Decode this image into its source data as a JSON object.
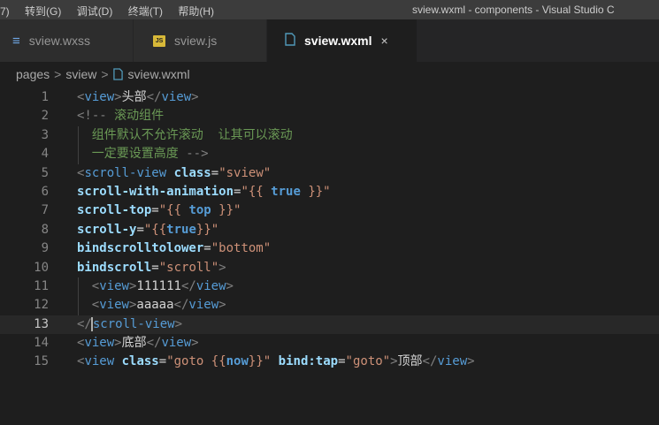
{
  "menu": {
    "items": [
      "7)",
      "转到(G)",
      "调试(D)",
      "终端(T)",
      "帮助(H)"
    ]
  },
  "window": {
    "title": "sview.wxml - components - Visual Studio C"
  },
  "tabs": [
    {
      "label": "sview.wxss",
      "icon": "css-file-icon",
      "active": false
    },
    {
      "label": "sview.js",
      "icon": "js-file-icon",
      "icon_text": "JS",
      "active": false
    },
    {
      "label": "sview.wxml",
      "icon": "file-icon",
      "active": true,
      "close": "×"
    }
  ],
  "breadcrumb": {
    "folder": "pages",
    "subfolder": "sview",
    "file": "sview.wxml",
    "separator": ">"
  },
  "editor": {
    "current_line": 13,
    "line_numbers": [
      "1",
      "2",
      "3",
      "4",
      "5",
      "6",
      "7",
      "8",
      "9",
      "10",
      "11",
      "12",
      "13",
      "14",
      "15"
    ],
    "lines": [
      [
        [
          "t",
          "<"
        ],
        [
          "tn",
          "view"
        ],
        [
          "t",
          ">"
        ],
        [
          "tx",
          "头部"
        ],
        [
          "t",
          "</"
        ],
        [
          "tn",
          "view"
        ],
        [
          "t",
          ">"
        ]
      ],
      [
        [
          "t",
          "<!--"
        ],
        [
          "cm",
          " 滚动组件"
        ]
      ],
      [
        [
          "cm",
          "组件默认不允许滚动  让其可以滚动"
        ]
      ],
      [
        [
          "cm",
          "一定要设置高度 "
        ],
        [
          "t",
          "-->"
        ]
      ],
      [
        [
          "t",
          "<"
        ],
        [
          "tn",
          "scroll-view"
        ],
        [
          "tx",
          " "
        ],
        [
          "an",
          "class"
        ],
        [
          "tx",
          "="
        ],
        [
          "av",
          "\"sview\""
        ]
      ],
      [
        [
          "an",
          "scroll-with-animation"
        ],
        [
          "tx",
          "="
        ],
        [
          "av",
          "\"{{ "
        ],
        [
          "ex",
          "true"
        ],
        [
          "av",
          " }}\""
        ]
      ],
      [
        [
          "an",
          "scroll-top"
        ],
        [
          "tx",
          "="
        ],
        [
          "av",
          "\"{{ "
        ],
        [
          "ex",
          "top"
        ],
        [
          "av",
          " }}\""
        ]
      ],
      [
        [
          "an",
          "scroll-y"
        ],
        [
          "tx",
          "="
        ],
        [
          "av",
          "\"{{"
        ],
        [
          "ex",
          "true"
        ],
        [
          "av",
          "}}\""
        ]
      ],
      [
        [
          "an",
          "bindscrolltolower"
        ],
        [
          "tx",
          "="
        ],
        [
          "av",
          "\"bottom\""
        ]
      ],
      [
        [
          "an",
          "bindscroll"
        ],
        [
          "tx",
          "="
        ],
        [
          "av",
          "\"scroll\""
        ],
        [
          "t",
          ">"
        ]
      ],
      [
        [
          "t",
          "<"
        ],
        [
          "tn",
          "view"
        ],
        [
          "t",
          ">"
        ],
        [
          "tx",
          "111111"
        ],
        [
          "t",
          "</"
        ],
        [
          "tn",
          "view"
        ],
        [
          "t",
          ">"
        ]
      ],
      [
        [
          "t",
          "<"
        ],
        [
          "tn",
          "view"
        ],
        [
          "t",
          ">"
        ],
        [
          "tx",
          "aaaaa"
        ],
        [
          "t",
          "</"
        ],
        [
          "tn",
          "view"
        ],
        [
          "t",
          ">"
        ]
      ],
      [
        [
          "t",
          "</"
        ],
        [
          "cursor",
          ""
        ],
        [
          "tn",
          "scroll-view"
        ],
        [
          "t",
          ">"
        ]
      ],
      [
        [
          "t",
          "<"
        ],
        [
          "tn",
          "view"
        ],
        [
          "t",
          ">"
        ],
        [
          "tx",
          "底部"
        ],
        [
          "t",
          "</"
        ],
        [
          "tn",
          "view"
        ],
        [
          "t",
          ">"
        ]
      ],
      [
        [
          "t",
          "<"
        ],
        [
          "tn",
          "view"
        ],
        [
          "tx",
          " "
        ],
        [
          "an",
          "class"
        ],
        [
          "tx",
          "="
        ],
        [
          "av",
          "\"goto {{"
        ],
        [
          "ex",
          "now"
        ],
        [
          "av",
          "}}\""
        ],
        [
          "tx",
          " "
        ],
        [
          "an",
          "bind:tap"
        ],
        [
          "tx",
          "="
        ],
        [
          "av",
          "\"goto\""
        ],
        [
          "t",
          ">"
        ],
        [
          "tx",
          "顶部"
        ],
        [
          "t",
          "</"
        ],
        [
          "tn",
          "view"
        ],
        [
          "t",
          ">"
        ]
      ]
    ]
  }
}
